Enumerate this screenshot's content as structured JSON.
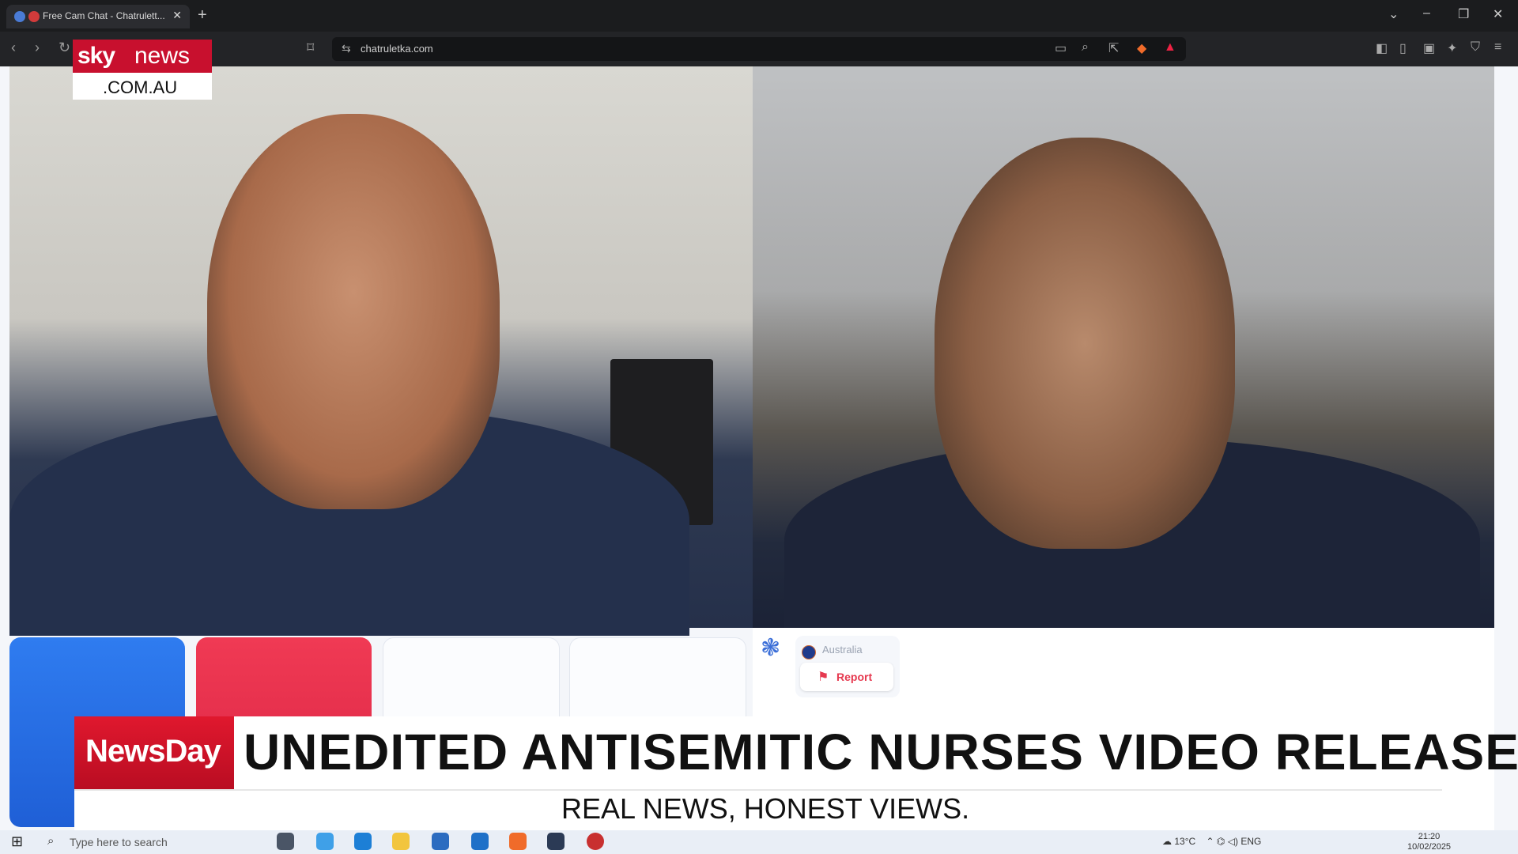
{
  "browser": {
    "tab_title": "Free Cam Chat - Chatrulett...",
    "tab_close": "✕",
    "new_tab": "+",
    "url": "chatruletka.com",
    "window_controls": [
      "⌄",
      "–",
      "❐",
      "✕"
    ]
  },
  "chat": {
    "country": "Australia",
    "report_label": "Report"
  },
  "broadcast": {
    "logo_sky": "sky",
    "logo_news": "news",
    "logo_domain": ".COM.AU",
    "show_name": "NewsDay",
    "headline": "UNEDITED ANTISEMITIC NURSES VIDEO RELEASED",
    "tagline": "REAL NEWS, HONEST VIEWS.",
    "brand_color": "#c8102e"
  },
  "taskbar": {
    "search_placeholder": "Type here to search",
    "weather": "13°C",
    "language": "ENG",
    "time": "21:20",
    "date": "10/02/2025"
  }
}
